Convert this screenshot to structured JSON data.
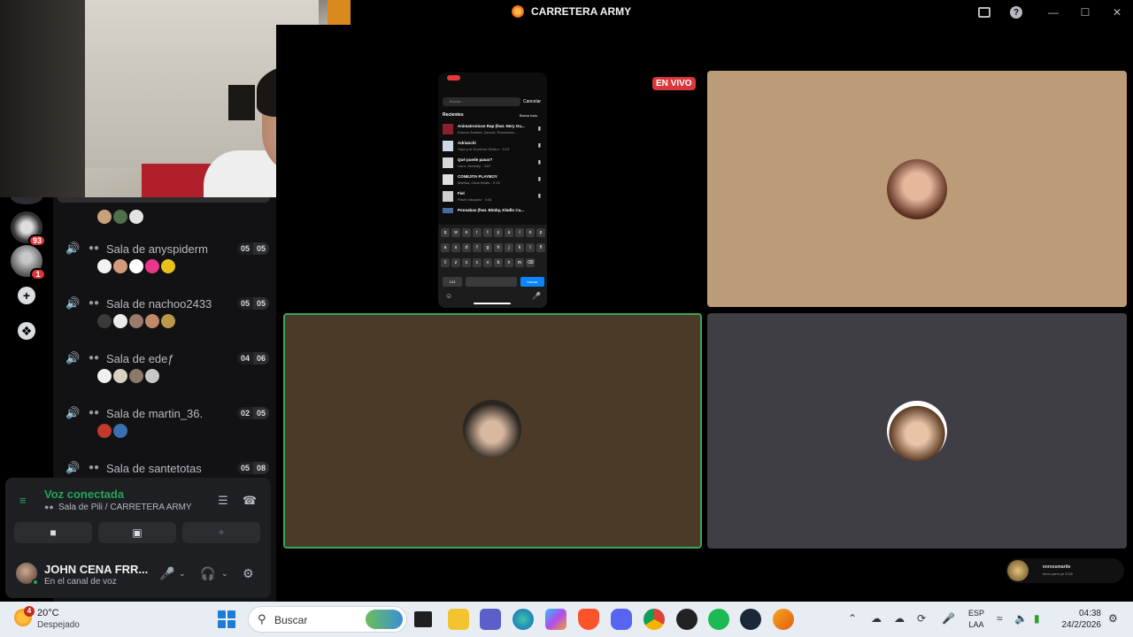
{
  "window": {
    "title": "CARRETERA ARMY"
  },
  "rail": {
    "badges": [
      "93",
      "1"
    ]
  },
  "rooms": [
    {
      "name": "Sala de anyspiderm",
      "count": "05",
      "limit": "05"
    },
    {
      "name": "Sala de nachoo2433",
      "count": "05",
      "limit": "05"
    },
    {
      "name": "Sala de edeƒ",
      "count": "04",
      "limit": "06"
    },
    {
      "name": "Sala de martin_36.",
      "count": "02",
      "limit": "05"
    },
    {
      "name": "Sala de santetotas",
      "count": "05",
      "limit": "08"
    }
  ],
  "voice": {
    "status": "Voz conectada",
    "channel": "Sala de Pili / CARRETERA ARMY"
  },
  "user": {
    "name": "JOHN CENA FRR...",
    "status": "En el canal de voz"
  },
  "stage": {
    "live_label": "EN VIVO",
    "phone": {
      "search_placeholder": "Buscar...",
      "cancel": "Cancelar",
      "recents": "Recientes",
      "clear_all": "Borrar todo",
      "items": [
        {
          "title": "Animatronicos Rap (feat. Nery Ou...",
          "sub": "Kronno Zomber, Zarcort, Rosendow..."
        },
        {
          "title": "Adrianchi",
          "sub": "Yayo y el Guerrero Obrero · 3:13"
        },
        {
          "title": "Qué puede pasar?",
          "sub": "LaLo, chesney · 3:57"
        },
        {
          "title": "CONEJITA PLAYBOY",
          "sub": "Matrika, Cano Beats · 2:19"
        },
        {
          "title": "Fiel",
          "sub": "Flavio Vazquez · 3:44"
        },
        {
          "title": "Ponsabas (feat. Bimby, Kladlo Ca...",
          "sub": ""
        }
      ],
      "keyboard_rows": [
        [
          "q",
          "w",
          "e",
          "r",
          "t",
          "y",
          "u",
          "i",
          "o",
          "p"
        ],
        [
          "a",
          "s",
          "d",
          "f",
          "g",
          "h",
          "j",
          "k",
          "l",
          "ñ"
        ],
        [
          "⇧",
          "z",
          "x",
          "c",
          "v",
          "b",
          "n",
          "m",
          "⌫"
        ]
      ],
      "num_key": "123",
      "go_key": "buscar"
    },
    "mini_user": {
      "name": "enrossmarite",
      "sub": "tiene pana ya 2026"
    }
  },
  "taskbar": {
    "weather_badge": "4",
    "temperature": "20°C",
    "condition": "Despejado",
    "search_label": "Buscar",
    "lang_1": "ESP",
    "lang_2": "LAA",
    "time": "04:38",
    "date": "24/2/2026"
  },
  "colors": {
    "speaking_border": "#3ba55d",
    "live_red": "#da373c",
    "tile_tan": "#bc9b78",
    "tile_brown": "#4a3a27",
    "tile_gray": "#3f3e45"
  }
}
